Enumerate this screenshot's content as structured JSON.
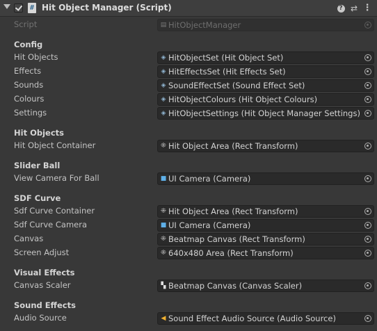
{
  "header": {
    "title": "Hit Object Manager (Script)",
    "help_glyph": "?",
    "preset_glyph": "⇄",
    "menu_glyph": "⋮"
  },
  "script_row": {
    "label": "Script",
    "value": "HitObjectManager",
    "icon": "script-file-icon"
  },
  "sections": {
    "config": "Config",
    "hit_objects": "Hit Objects",
    "slider_ball": "Slider Ball",
    "sdf_curve": "SDF Curve",
    "visual_effects": "Visual Effects",
    "sound_effects": "Sound Effects"
  },
  "fields": {
    "hit_objects": {
      "label": "Hit Objects",
      "value": "HitObjectSet (Hit Object Set)",
      "icon": "scriptable-object-icon"
    },
    "effects": {
      "label": "Effects",
      "value": "HitEffectsSet (Hit Effects Set)",
      "icon": "scriptable-object-icon"
    },
    "sounds": {
      "label": "Sounds",
      "value": "SoundEffectSet (Sound Effect Set)",
      "icon": "scriptable-object-icon"
    },
    "colours": {
      "label": "Colours",
      "value": "HitObjectColours (Hit Object Colours)",
      "icon": "scriptable-object-icon"
    },
    "settings": {
      "label": "Settings",
      "value": "HitObjectSettings (Hit Object Manager Settings)",
      "icon": "scriptable-object-icon"
    },
    "hit_object_container": {
      "label": "Hit Object Container",
      "value": "Hit Object Area (Rect Transform)",
      "icon": "rect-transform-icon"
    },
    "view_camera_for_ball": {
      "label": "View Camera For Ball",
      "value": "UI Camera (Camera)",
      "icon": "camera-icon"
    },
    "sdf_curve_container": {
      "label": "Sdf Curve Container",
      "value": "Hit Object Area (Rect Transform)",
      "icon": "rect-transform-icon"
    },
    "sdf_curve_camera": {
      "label": "Sdf Curve Camera",
      "value": "UI Camera (Camera)",
      "icon": "camera-icon"
    },
    "canvas": {
      "label": "Canvas",
      "value": "Beatmap Canvas (Rect Transform)",
      "icon": "rect-transform-icon"
    },
    "screen_adjust": {
      "label": "Screen Adjust",
      "value": "640x480 Area (Rect Transform)",
      "icon": "rect-transform-icon"
    },
    "canvas_scaler": {
      "label": "Canvas Scaler",
      "value": "Beatmap Canvas (Canvas Scaler)",
      "icon": "canvas-scaler-icon"
    },
    "audio_source": {
      "label": "Audio Source",
      "value": "Sound Effect Audio Source (Audio Source)",
      "icon": "audio-source-icon"
    }
  }
}
